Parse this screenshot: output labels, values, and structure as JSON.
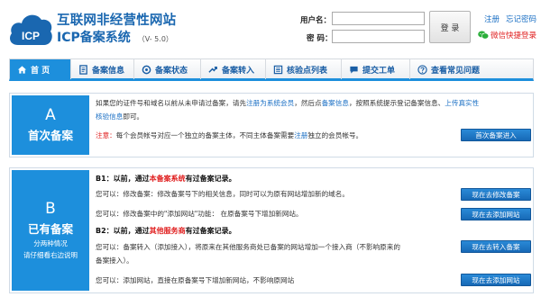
{
  "header": {
    "brand_line1": "互联网非经营性网站",
    "brand_line2": "ICP备案系统",
    "version": "（V- 5.0）",
    "logo_text": "ICP",
    "username_label": "用户名：",
    "password_label": "密  码：",
    "username_value": "",
    "password_value": "",
    "login_label": "登 录",
    "register_label": "注册",
    "forgot_label": "忘记密码",
    "wechat_label": "微信快捷登录",
    "wechat_icon": "wechat-icon"
  },
  "nav": {
    "tabs": [
      {
        "label": "首 页",
        "icon": "home-icon"
      },
      {
        "label": "备案信息",
        "icon": "document-icon"
      },
      {
        "label": "备案状态",
        "icon": "status-icon"
      },
      {
        "label": "备案转入",
        "icon": "transfer-icon"
      },
      {
        "label": "核验点列表",
        "icon": "list-icon"
      },
      {
        "label": "提交工单",
        "icon": "chat-icon"
      },
      {
        "label": "查看常见问题",
        "icon": "help-icon"
      }
    ]
  },
  "section_a": {
    "letter": "A",
    "title": "首次备案",
    "line1_pre": "如果您的证件号和域名以前从未申请过备案，请先",
    "line1_link1": "注册为系统会员",
    "line1_mid": "，然后点",
    "line1_link2": "备案信息",
    "line1_post": "，按照系统提示登记备案信息、",
    "line1_link3": "上传真实性",
    "line2_link": "核验信息",
    "line2_post": "即可。",
    "note_label": "注意：",
    "note_text": "每个会员帐号对应一个独立的备案主体，不同主体备案需要",
    "note_link": "注册",
    "note_post": "独立的会员帐号。",
    "button": "首次备案进入"
  },
  "section_b": {
    "letter": "B",
    "title": "已有备案",
    "sub1": "分两种情况",
    "sub2": "请仔细看右边说明",
    "b1_pre": "B1：以前，通过",
    "b1_red": "本备案系统",
    "b1_post": "有过备案记录。",
    "b1_line1": "您可以：修改备案：修改备案号下的相关信息，同时可以为原有网站增加新的域名。",
    "b1_line2": "您可以：修改备案中的\"添加网站\"功能： 在原备案号下增加新网站。",
    "b1_btn1": "现在去修改备案",
    "b1_btn2": "现在去添加网站",
    "b2_pre": "B2：以前，通过",
    "b2_red": "其他服务商",
    "b2_post": "有过备案记录。",
    "b2_line1": "您可以：备案转入（添加接入），将原来在其他服务商处已备案的网站增加一个接入商（不影响原来的",
    "b2_line2": "备案接入）。",
    "b2_line3": "您可以：添加网站，直接在原备案号下增加新网站，不影响原网站",
    "b2_btn1": "现在去转入备案",
    "b2_btn2": "现在去添加网站"
  },
  "colors": {
    "accent": "#1d8fdc",
    "link": "#1a6fc4",
    "alert": "#e02020"
  }
}
